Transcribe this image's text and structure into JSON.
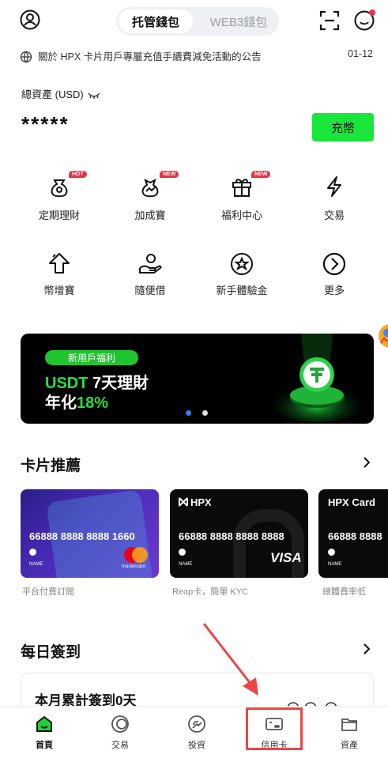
{
  "header": {
    "tabs": [
      "托管錢包",
      "WEB3錢包"
    ],
    "active_tab": "托管錢包"
  },
  "notice": {
    "text": "關於 HPX 卡片用戶專屬充值手續費減免活動的公告",
    "date": "01-12"
  },
  "assets": {
    "label": "總資產 (USD)",
    "value": "*****",
    "deposit_label": "充幣"
  },
  "features": [
    {
      "label": "定期理財",
      "badge": "HOT",
      "icon": "money-bag-icon"
    },
    {
      "label": "加成寶",
      "badge": "NEW",
      "icon": "boost-bag-icon"
    },
    {
      "label": "福利中心",
      "badge": "NEW",
      "icon": "gift-icon"
    },
    {
      "label": "交易",
      "badge": "",
      "icon": "lightning-icon"
    },
    {
      "label": "幣增寶",
      "badge": "",
      "icon": "arrow-up-icon"
    },
    {
      "label": "隨便借",
      "badge": "",
      "icon": "hand-coin-icon"
    },
    {
      "label": "新手體驗金",
      "badge": "",
      "icon": "star-badge-icon"
    },
    {
      "label": "更多",
      "badge": "",
      "icon": "chevron-circle-icon"
    }
  ],
  "banner": {
    "pill": "新用戶福利",
    "line1_a": "USDT",
    "line1_b": " 7天理財",
    "line2_a": "年化",
    "line2_b": "18%"
  },
  "cards_section": {
    "title": "卡片推薦",
    "cards": [
      {
        "number": "66888 8888 8888 1660",
        "name": "NAME",
        "brand": "mastercard",
        "caption": "平台付費訂閱"
      },
      {
        "logo": "HPX",
        "number": "66888 8888 8888 8888",
        "name": "NAME",
        "brand": "VISA",
        "caption": "Reap卡，簡單 KYC"
      },
      {
        "logo": "HPX Card",
        "number": "66888 8888",
        "name": "NAME",
        "caption": "總體費率低"
      }
    ]
  },
  "checkin": {
    "title": "每日簽到",
    "text": "本月累計簽到0天"
  },
  "nav": [
    {
      "label": "首頁",
      "icon": "home-icon"
    },
    {
      "label": "交易",
      "icon": "trade-icon"
    },
    {
      "label": "投資",
      "icon": "invest-icon"
    },
    {
      "label": "信用卡",
      "icon": "credit-card-icon"
    },
    {
      "label": "資產",
      "icon": "folder-icon"
    }
  ],
  "colors": {
    "accent": "#19e63a",
    "badge": "#e53347",
    "highlight": "#ef4444"
  }
}
